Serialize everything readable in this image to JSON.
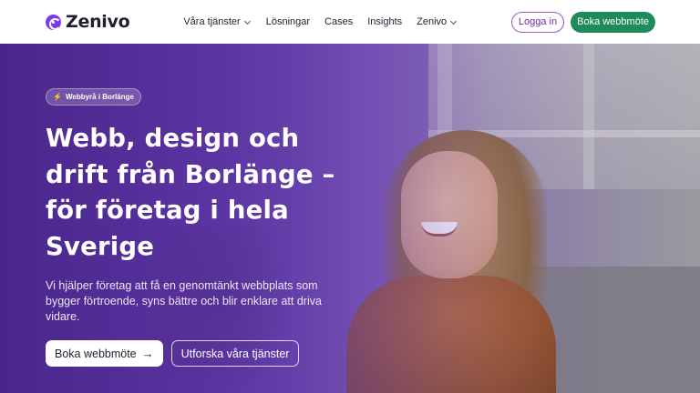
{
  "brand": {
    "name": "Zenivo",
    "accent": "#7c3aed",
    "cta_green": "#1f8a5a"
  },
  "nav": {
    "items": [
      {
        "label": "Våra tjänster",
        "has_dropdown": true
      },
      {
        "label": "Lösningar",
        "has_dropdown": false
      },
      {
        "label": "Cases",
        "has_dropdown": false
      },
      {
        "label": "Insights",
        "has_dropdown": false
      },
      {
        "label": "Zenivo",
        "has_dropdown": true
      }
    ]
  },
  "header": {
    "login_label": "Logga in",
    "book_label": "Boka webbmöte"
  },
  "hero": {
    "badge": "Webbyrå i Borlänge",
    "badge_icon": "bolt-icon",
    "title": "Webb, design och drift från Borlänge – för företag i hela Sverige",
    "subtitle": "Vi hjälper företag att få en genomtänkt webbplats som bygger förtroende, syns bättre och blir enklare att driva vidare.",
    "primary_cta": "Boka webbmöte",
    "primary_cta_icon": "arrow-right-icon",
    "secondary_cta": "Utforska våra tjänster"
  }
}
